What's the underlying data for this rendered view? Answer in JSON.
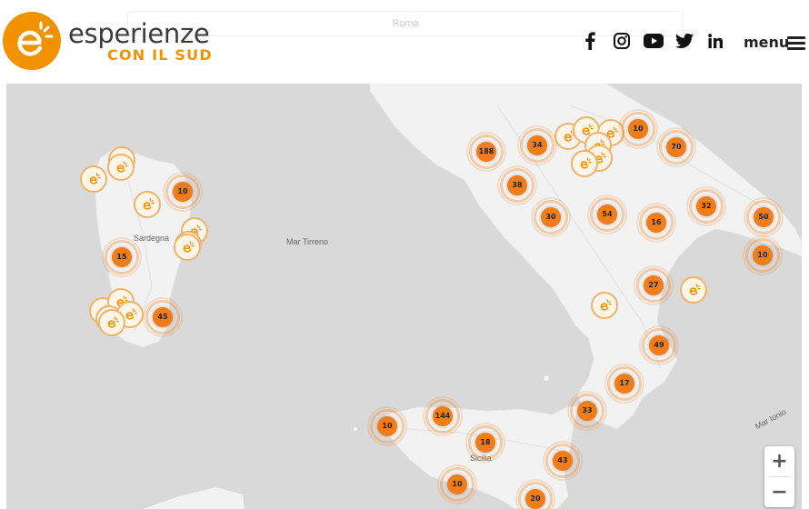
{
  "header": {
    "brand_name": "esperienze",
    "brand_tagline": "CON IL SUD",
    "search_hint": "Roma",
    "social_icons": [
      "facebook-icon",
      "instagram-icon",
      "youtube-icon",
      "twitter-icon",
      "linkedin-icon"
    ],
    "menu_label": "menu"
  },
  "map": {
    "place_labels": {
      "sardegna": "Sardegna",
      "mar_tirreno": "Mar Tirreno",
      "sicilia": "Sicilia",
      "mar_ionio": "Mar Ionio"
    },
    "clusters": [
      "10",
      "15",
      "45",
      "188",
      "34",
      "10",
      "70",
      "38",
      "30",
      "54",
      "16",
      "32",
      "50",
      "10",
      "27",
      "49",
      "17",
      "33",
      "144",
      "10",
      "18",
      "43",
      "10",
      "20"
    ],
    "single_pin_count": 20,
    "colors": {
      "land": "#f2f2f2",
      "sea": "#d9d9d9",
      "cluster": "#f07d1a",
      "brand": "#f39200"
    }
  },
  "zoom": {
    "in_label": "+",
    "out_label": "−"
  }
}
